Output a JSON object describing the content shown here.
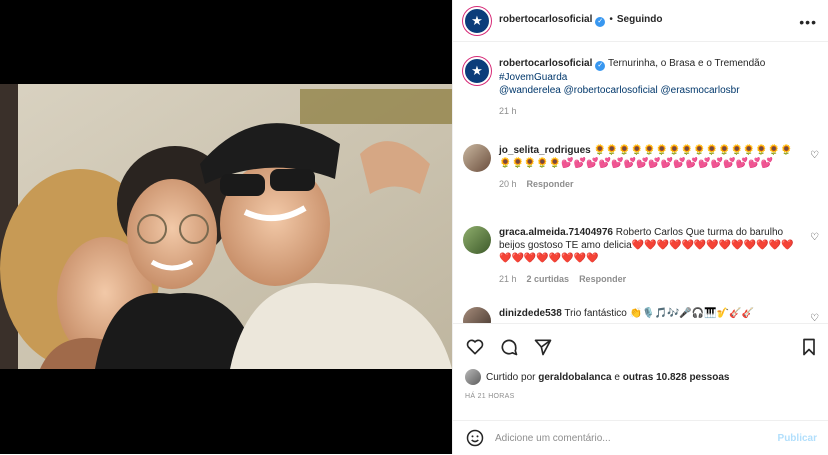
{
  "header": {
    "username": "robertocarlosoficial",
    "separator": "•",
    "follow_status": "Seguindo",
    "more": "•••"
  },
  "caption": {
    "username": "robertocarlosoficial",
    "text": "Ternurinha, o Brasa e o Tremendão",
    "hashtag": "#JovemGuarda",
    "mentions": "@wanderelea @robertocarlosoficial @erasmocarlosbr",
    "time": "21 h"
  },
  "comments": [
    {
      "username": "jo_selita_rodrigues",
      "text": "🌻🌻🌻🌻🌻🌻🌻🌻🌻🌻🌻🌻🌻🌻🌻🌻🌻🌻🌻🌻🌻💕💕💕💕💕💕💕💕💕💕💕💕💕💕💕💕💕",
      "time": "20 h",
      "reply": "Responder"
    },
    {
      "username": "graca.almeida.71404976",
      "text": "Roberto Carlos Que turma do barulho beijos gostoso TE amo delicia❤️❤️❤️❤️❤️❤️❤️❤️❤️❤️❤️❤️❤️❤️❤️❤️❤️❤️❤️❤️❤️",
      "time": "21 h",
      "likes": "2 curtidas",
      "reply": "Responder"
    },
    {
      "username": "dinizdede538",
      "text": "Trio fantástico 👏🎙️🎵🎶🎤🎧🎹🎷🎸🎸"
    }
  ],
  "likes": {
    "prefix": "Curtido por",
    "user": "geraldobalanca",
    "middle": "e",
    "others": "outras 10.828 pessoas"
  },
  "timestamp": "HÁ 21 HORAS",
  "composer": {
    "placeholder": "Adicione um comentário...",
    "publish": "Publicar"
  },
  "icons": {
    "like": "heart-icon",
    "comment": "comment-icon",
    "share": "share-icon",
    "save": "bookmark-icon",
    "emoji": "emoji-icon"
  },
  "colors": {
    "link": "#00376b",
    "muted": "#8e8e8e",
    "verified": "#3897f0",
    "publish_disabled": "#b2dffc"
  }
}
